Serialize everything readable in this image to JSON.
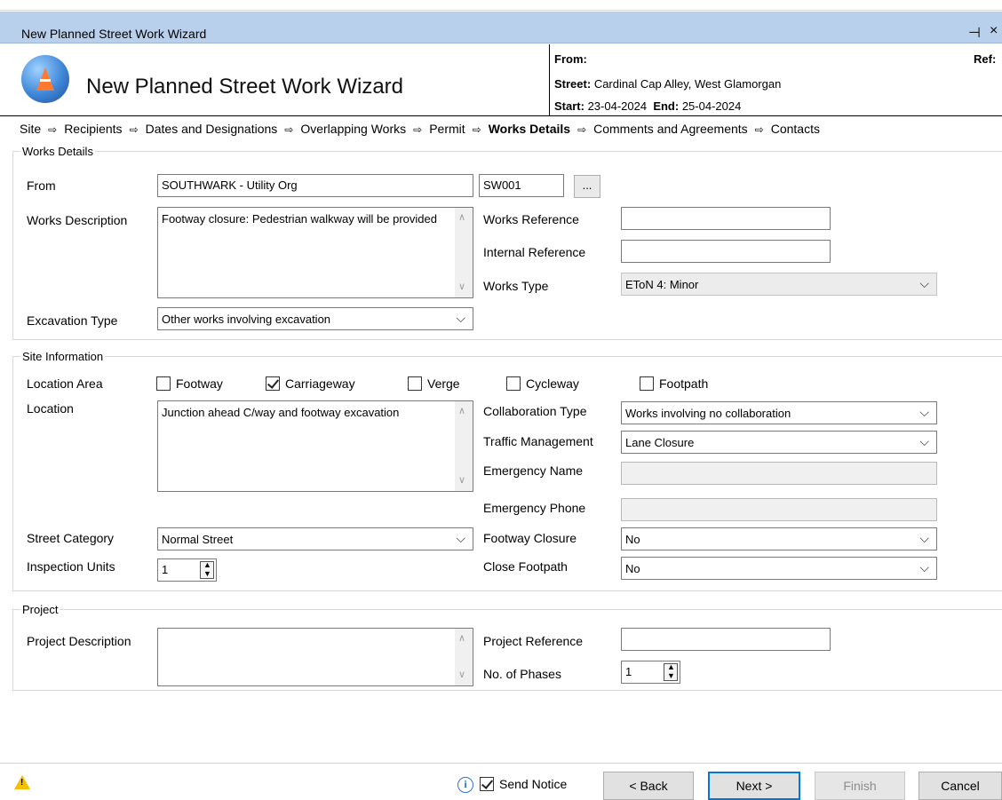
{
  "window": {
    "title": "New Planned Street Work Wizard",
    "pin_glyph": "⊣",
    "close_glyph": "×"
  },
  "header": {
    "title": "New Planned Street Work Wizard",
    "from_label": "From:",
    "from_value": "",
    "ref_label": "Ref:",
    "street_label": "Street:",
    "street_value": "Cardinal Cap Alley, West Glamorgan",
    "start_label": "Start:",
    "start_value": "23-04-2024",
    "end_label": "End:",
    "end_value": "25-04-2024"
  },
  "breadcrumb": {
    "steps": [
      "Site",
      "Recipients",
      "Dates and Designations",
      "Overlapping Works",
      "Permit",
      "Works Details",
      "Comments and Agreements",
      "Contacts"
    ],
    "active_index": 5,
    "arrow": "⇨"
  },
  "works_details": {
    "legend": "Works Details",
    "from_label": "From",
    "from_value": "SOUTHWARK - Utility Org",
    "from_code": "SW001",
    "browse_label": "...",
    "works_description_label": "Works Description",
    "works_description_value": "Footway closure: Pedestrian walkway will be provided",
    "works_reference_label": "Works Reference",
    "works_reference_value": "",
    "internal_reference_label": "Internal Reference",
    "internal_reference_value": "",
    "works_type_label": "Works Type",
    "works_type_value": "EToN 4: Minor",
    "excavation_type_label": "Excavation Type",
    "excavation_type_value": "Other works involving excavation"
  },
  "site_information": {
    "legend": "Site Information",
    "location_area_label": "Location Area",
    "location_areas": [
      {
        "label": "Footway",
        "checked": false
      },
      {
        "label": "Carriageway",
        "checked": true
      },
      {
        "label": "Verge",
        "checked": false
      },
      {
        "label": "Cycleway",
        "checked": false
      },
      {
        "label": "Footpath",
        "checked": false
      }
    ],
    "location_label": "Location",
    "location_value": "Junction ahead C/way and footway excavation",
    "collaboration_type_label": "Collaboration Type",
    "collaboration_type_value": "Works involving no collaboration",
    "traffic_management_label": "Traffic Management",
    "traffic_management_value": "Lane Closure",
    "emergency_name_label": "Emergency Name",
    "emergency_name_value": "",
    "emergency_phone_label": "Emergency Phone",
    "emergency_phone_value": "",
    "street_category_label": "Street Category",
    "street_category_value": "Normal Street",
    "footway_closure_label": "Footway Closure",
    "footway_closure_value": "No",
    "inspection_units_label": "Inspection Units",
    "inspection_units_value": "1",
    "close_footpath_label": "Close Footpath",
    "close_footpath_value": "No"
  },
  "project": {
    "legend": "Project",
    "project_description_label": "Project Description",
    "project_description_value": "",
    "project_reference_label": "Project Reference",
    "project_reference_value": "",
    "phases_label": "No. of Phases",
    "phases_value": "1"
  },
  "footer": {
    "send_notice_label": "Send Notice",
    "send_notice_checked": true,
    "back_label": "< Back",
    "next_label": "Next >",
    "finish_label": "Finish",
    "cancel_label": "Cancel",
    "warning_glyph": "!",
    "info_glyph": "i"
  },
  "icons": {
    "logo": "traffic-cone-logo-icon",
    "warning": "warning-icon",
    "info": "info-icon",
    "chevron": "chevron-down-icon"
  },
  "colors": {
    "titlebar": "#b8d0ec",
    "primary_border": "#0078d7",
    "warning": "#f2c200",
    "info": "#2f6fd1"
  }
}
